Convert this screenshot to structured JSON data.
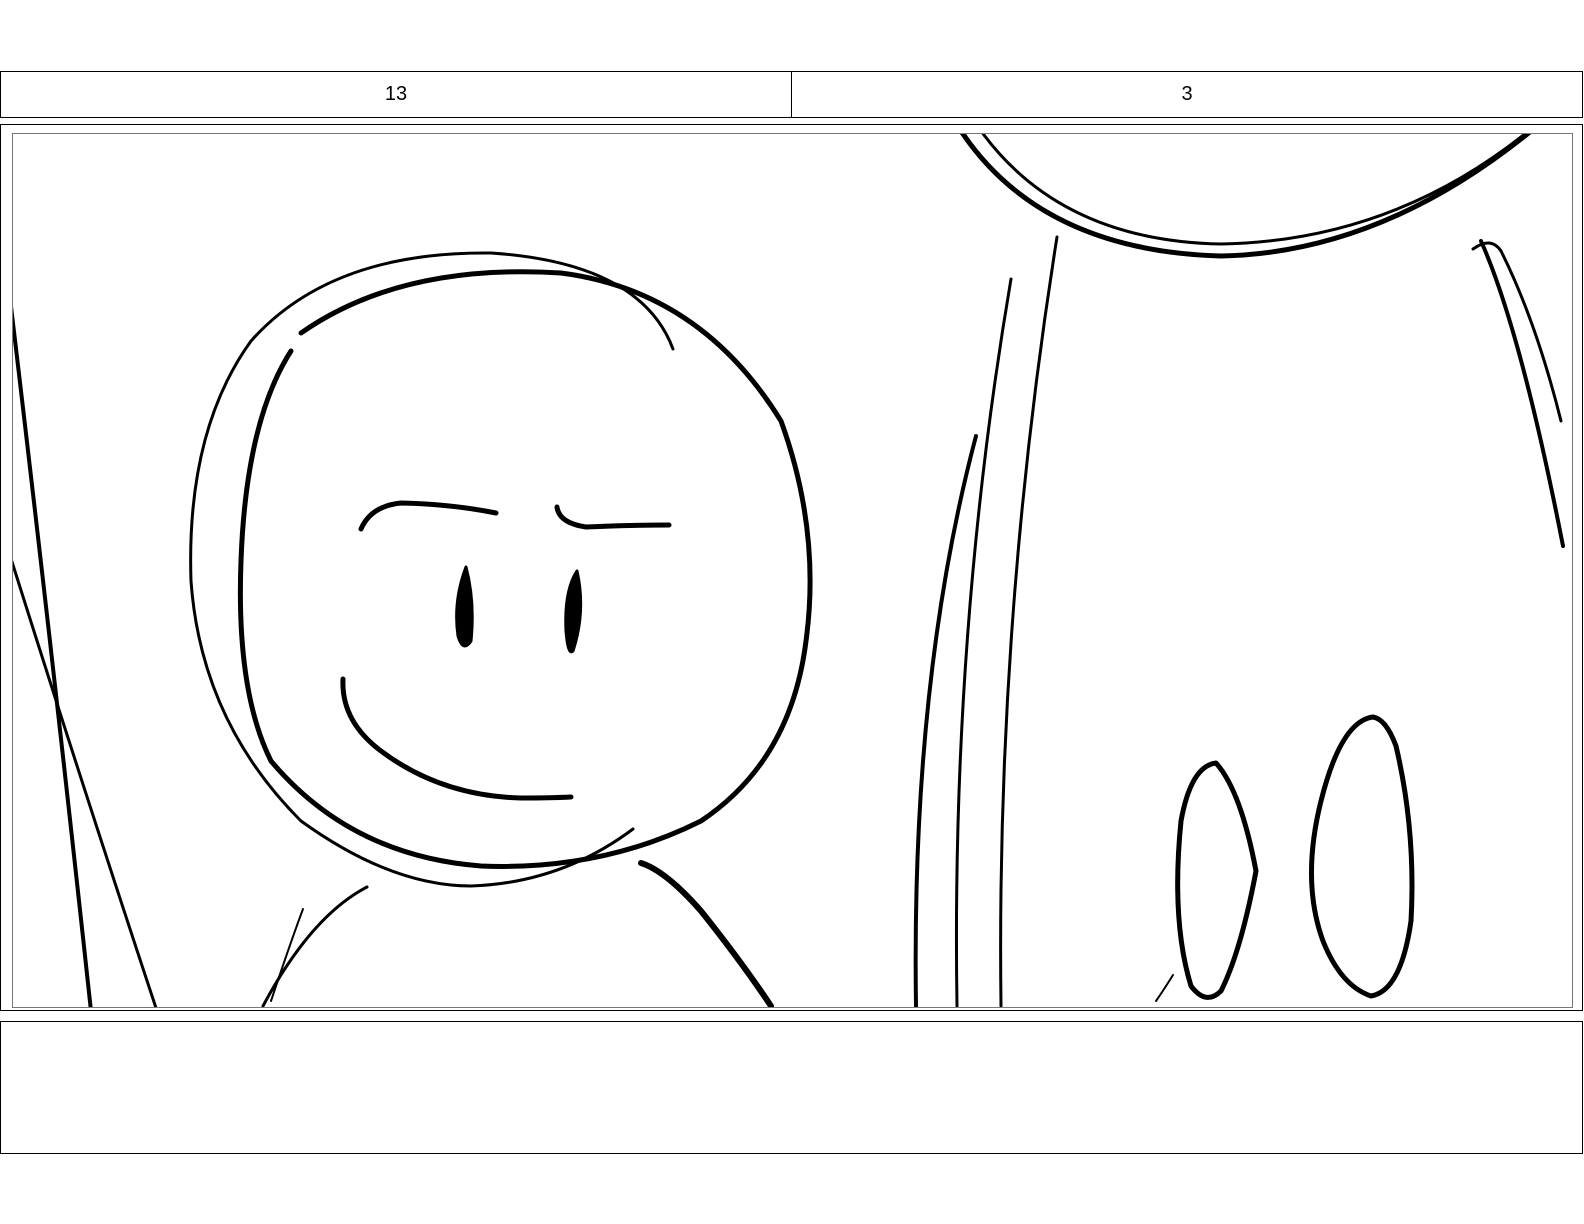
{
  "storyboard": {
    "header": {
      "scene_number": "13",
      "panel_number": "3"
    },
    "notes": {
      "text": ""
    }
  },
  "colors": {
    "line": "#000000",
    "background": "#ffffff"
  }
}
